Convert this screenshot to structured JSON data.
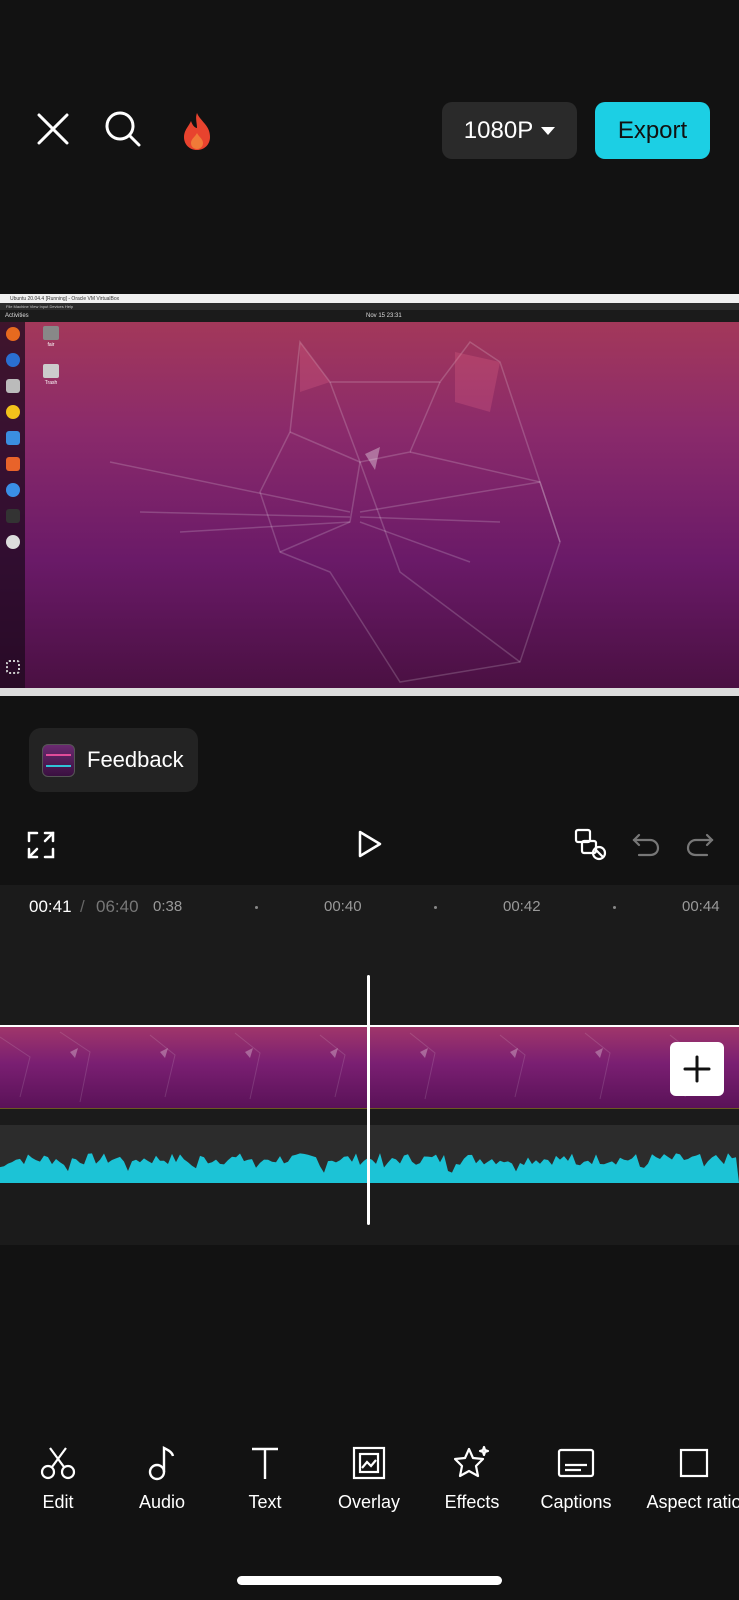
{
  "header": {
    "resolution": "1080P",
    "export_label": "Export"
  },
  "preview": {
    "window_title": "Ubuntu 20.04.4 [Running] - Oracle VM VirtualBox",
    "menu": "File   Machine   View   Input   Devices   Help",
    "activities": "Activities",
    "clock": "Nov 15  23:31",
    "desktop_icons": [
      "fair",
      "Trash"
    ]
  },
  "feedback": {
    "label": "Feedback"
  },
  "timeline": {
    "current_time": "00:41",
    "separator": "/",
    "total_time": "06:40",
    "ticks": [
      "0:38",
      "00:40",
      "00:42",
      "00:44"
    ]
  },
  "toolbar": {
    "items": [
      {
        "label": "Edit",
        "icon": "scissors-icon"
      },
      {
        "label": "Audio",
        "icon": "music-note-icon"
      },
      {
        "label": "Text",
        "icon": "text-icon"
      },
      {
        "label": "Overlay",
        "icon": "overlay-icon"
      },
      {
        "label": "Effects",
        "icon": "effects-star-icon"
      },
      {
        "label": "Captions",
        "icon": "captions-icon"
      },
      {
        "label": "Aspect ratio",
        "icon": "aspect-ratio-icon"
      }
    ]
  },
  "colors": {
    "accent": "#1ccfe4",
    "background": "#121212",
    "audio_wave": "#1cc3d6"
  }
}
